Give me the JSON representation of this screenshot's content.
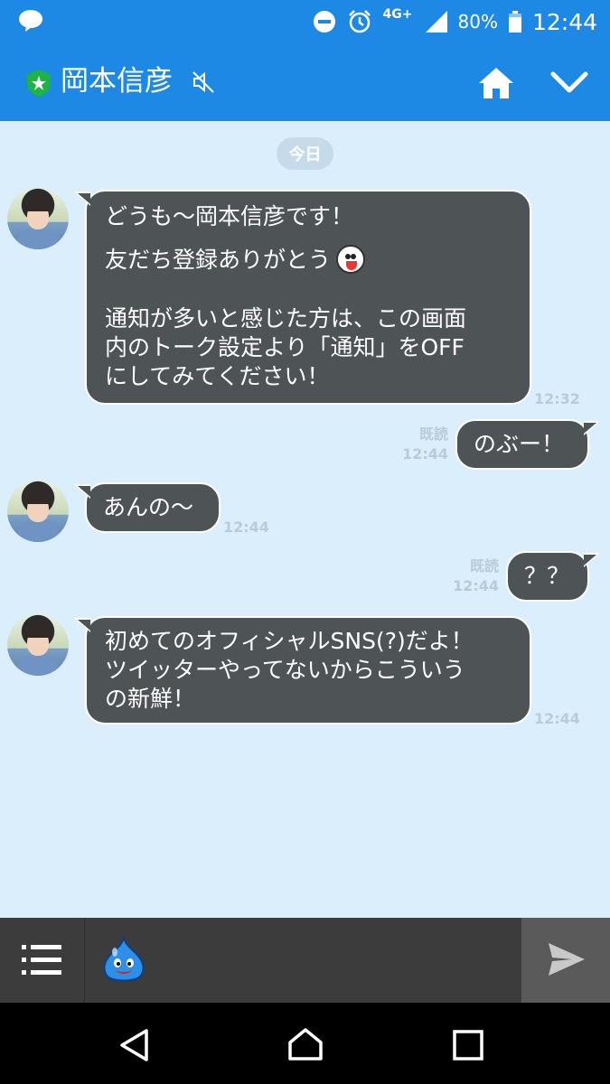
{
  "status_bar": {
    "network": "4G+",
    "battery": "80%",
    "time": "12:44"
  },
  "header": {
    "title": "岡本信彦"
  },
  "chat": {
    "date_label": "今日",
    "messages": [
      {
        "side": "left",
        "paragraphs": [
          [
            "どうも〜岡本信彦です！"
          ],
          [
            "友だち登録ありがとう"
          ],
          [
            "通知が多いと感じた方は、この画面",
            "内のトーク設定より「通知」をOFF",
            "にしてみてください！"
          ]
        ],
        "time": "12:32"
      },
      {
        "side": "right",
        "text": "のぶー！",
        "read": "既読",
        "time": "12:44"
      },
      {
        "side": "left",
        "text": "あんの〜",
        "time": "12:44"
      },
      {
        "side": "right",
        "text": "？？",
        "read": "既読",
        "time": "12:44"
      },
      {
        "side": "left",
        "lines": [
          "初めてのオフィシャルSNS(?)だよ！",
          "ツイッターやってないからこういう",
          "の新鮮！"
        ],
        "time": "12:44"
      }
    ]
  },
  "colors": {
    "brand_blue": "#1e88e5",
    "chat_bg": "#dbeefc",
    "bubble": "#4e5356",
    "input_bar": "#3c3c3c"
  },
  "icons": {
    "status": [
      "line-app-icon",
      "do-not-disturb-icon",
      "alarm-icon",
      "signal-icon",
      "battery-icon"
    ],
    "header": [
      "official-shield-icon",
      "mute-icon",
      "home-icon",
      "chevron-down-icon"
    ],
    "input": [
      "menu-icon",
      "slime-sticker-icon",
      "send-icon"
    ],
    "nav": [
      "back-icon",
      "home-nav-icon",
      "recents-icon"
    ]
  }
}
